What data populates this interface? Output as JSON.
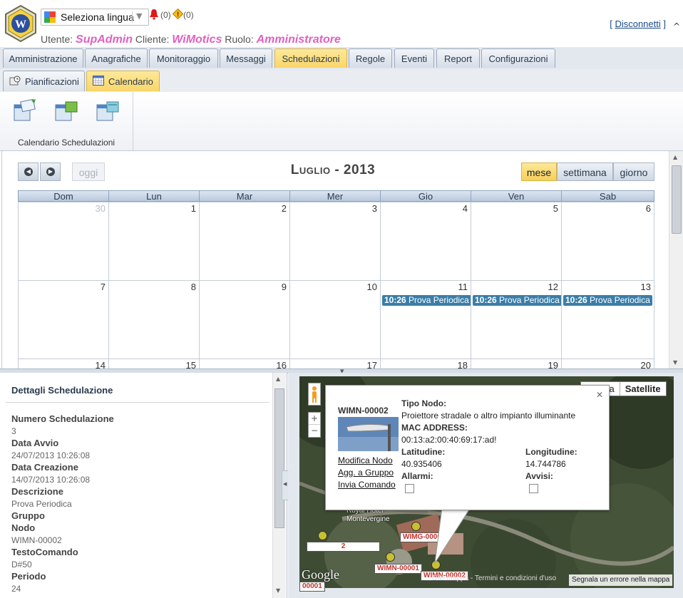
{
  "header": {
    "language_select": "Seleziona lingua",
    "alarm_count": "(0)",
    "warning_count": "(0)",
    "user_label": "Utente:",
    "user_value": "SupAdmin",
    "client_label": "Cliente:",
    "client_value": "WiMotics",
    "role_label": "Ruolo:",
    "role_value": "Amministratore",
    "logout_open": "[",
    "logout_label": "Disconnetti",
    "logout_close": "]"
  },
  "tabs": [
    {
      "label": "Amministrazione",
      "active": false
    },
    {
      "label": "Anagrafiche",
      "active": false
    },
    {
      "label": "Monitoraggio",
      "active": false
    },
    {
      "label": "Messaggi",
      "active": false
    },
    {
      "label": "Schedulazioni",
      "active": true
    },
    {
      "label": "Regole",
      "active": false
    },
    {
      "label": "Eventi",
      "active": false
    },
    {
      "label": "Report",
      "active": false
    },
    {
      "label": "Configurazioni",
      "active": false
    }
  ],
  "subtabs": [
    {
      "label": "Pianificazioni",
      "active": false,
      "icon": "schedule-icon"
    },
    {
      "label": "Calendario",
      "active": true,
      "icon": "calendar-icon"
    }
  ],
  "ribbon": {
    "group_label": "Calendario Schedulazioni",
    "buttons": [
      "add-schedule-icon",
      "edit-schedule-icon",
      "delete-schedule-icon"
    ]
  },
  "calendar": {
    "title": "Luglio - 2013",
    "today_label": "oggi",
    "views": [
      {
        "label": "mese",
        "active": true
      },
      {
        "label": "settimana",
        "active": false
      },
      {
        "label": "giorno",
        "active": false
      }
    ],
    "weekdays": [
      "Dom",
      "Lun",
      "Mar",
      "Mer",
      "Gio",
      "Ven",
      "Sab"
    ],
    "weeks": [
      [
        {
          "day": "30",
          "other": true
        },
        {
          "day": "1"
        },
        {
          "day": "2"
        },
        {
          "day": "3"
        },
        {
          "day": "4"
        },
        {
          "day": "5"
        },
        {
          "day": "6"
        }
      ],
      [
        {
          "day": "7"
        },
        {
          "day": "8"
        },
        {
          "day": "9"
        },
        {
          "day": "10"
        },
        {
          "day": "11",
          "event_time": "10:26",
          "event_title": "Prova Periodica"
        },
        {
          "day": "12",
          "event_time": "10:26",
          "event_title": "Prova Periodica"
        },
        {
          "day": "13",
          "event_time": "10:26",
          "event_title": "Prova Periodica"
        }
      ],
      [
        {
          "day": "14"
        },
        {
          "day": "15"
        },
        {
          "day": "16"
        },
        {
          "day": "17"
        },
        {
          "day": "18"
        },
        {
          "day": "19"
        },
        {
          "day": "20"
        }
      ]
    ]
  },
  "details": {
    "title": "Dettagli Schedulazione",
    "fields": [
      {
        "label": "Numero Schedulazione",
        "value": "3"
      },
      {
        "label": "Data Avvio",
        "value": "24/07/2013 10:26:08"
      },
      {
        "label": "Data Creazione",
        "value": "14/07/2013 10:26:08"
      },
      {
        "label": "Descrizione",
        "value": "Prova Periodica"
      },
      {
        "label": "Gruppo",
        "value": ""
      },
      {
        "label": "Nodo",
        "value": "WIMN-00002"
      },
      {
        "label": "TestoComando",
        "value": "D#50"
      },
      {
        "label": "Periodo",
        "value": "24"
      }
    ]
  },
  "map": {
    "type_map": "Mappa",
    "type_satellite": "Satellite",
    "popup": {
      "node_id": "WIMN-00002",
      "type_label": "Tipo Nodo:",
      "type_value": "Proiettore stradale o altro impianto illuminante",
      "mac_label": "MAC ADDRESS:",
      "mac_value": "00:13:a2:00:40:69:17:ad!",
      "lat_label": "Latitudine:",
      "lat_value": "40.935406",
      "lon_label": "Longitudine:",
      "lon_value": "14.744786",
      "alarms_label": "Allarmi:",
      "warnings_label": "Avvisi:",
      "link_modify": "Modifica Nodo",
      "link_group": "Agg. a Gruppo",
      "link_command": "Invia Comando"
    },
    "markers": [
      "WIMG-00001",
      "WIMN-00001",
      "WIMN-00002",
      "2",
      "00001"
    ],
    "place_label": "Royal Hotel Montevergine",
    "google_logo": "Google",
    "footer_data": "Dati mappa",
    "footer_terms": "Termini e condizioni d'uso",
    "footer_error": "Segnala un errore nella mappa"
  }
}
